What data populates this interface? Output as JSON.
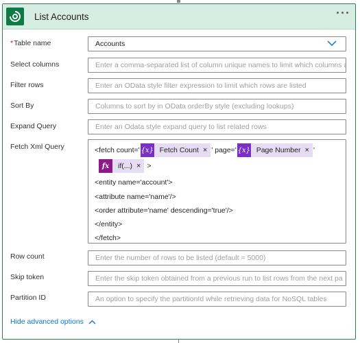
{
  "header": {
    "title": "List Accounts",
    "menu_icon": "more-icon"
  },
  "fields": [
    {
      "label": "Table name",
      "required": true,
      "value": "Accounts",
      "placeholder": ""
    },
    {
      "label": "Select columns",
      "placeholder": "Enter a comma-separated list of column unique names to limit which columns a"
    },
    {
      "label": "Filter rows",
      "placeholder": "Enter an OData style filter expression to limit which rows are listed"
    },
    {
      "label": "Sort By",
      "placeholder": "Columns to sort by in OData orderBy style (excluding lookups)"
    },
    {
      "label": "Expand Query",
      "placeholder": "Enter an Odata style expand query to list related rows"
    },
    {
      "label": "Fetch Xml Query"
    },
    {
      "label": "Row count",
      "placeholder": "Enter the number of rows to be listed (default = 5000)"
    },
    {
      "label": "Skip token",
      "placeholder": "Enter the skip token obtained from a previous run to list rows from the next pa"
    },
    {
      "label": "Partition ID",
      "placeholder": "An option to specify the partitionId while retrieving data for NoSQL tables"
    }
  ],
  "fetch_xml": {
    "line1_prefix": "<fetch count='",
    "token_fetch_count": "Fetch Count",
    "line1_mid": "' page='",
    "token_page_number": "Page Number",
    "line1_suffix": "'",
    "token_if": "if(...)",
    "line2_suffix": ">",
    "lines": [
      "<entity name='account'>",
      "<attribute name='name'/>",
      "<order attribute='name' descending='true'/>",
      "</entity>",
      "</fetch>"
    ],
    "token_var_icon": "{x}",
    "token_fx_icon": "fx",
    "remove_glyph": "×"
  },
  "footer": {
    "advanced_toggle": "Hide advanced options"
  },
  "colors": {
    "header_bg": "#d5ede2",
    "border": "#2e7d4f",
    "logo": "#0e7a45",
    "link": "#0078d4",
    "var_token": "#7c2fc6",
    "fx_token": "#8a1a8a"
  }
}
